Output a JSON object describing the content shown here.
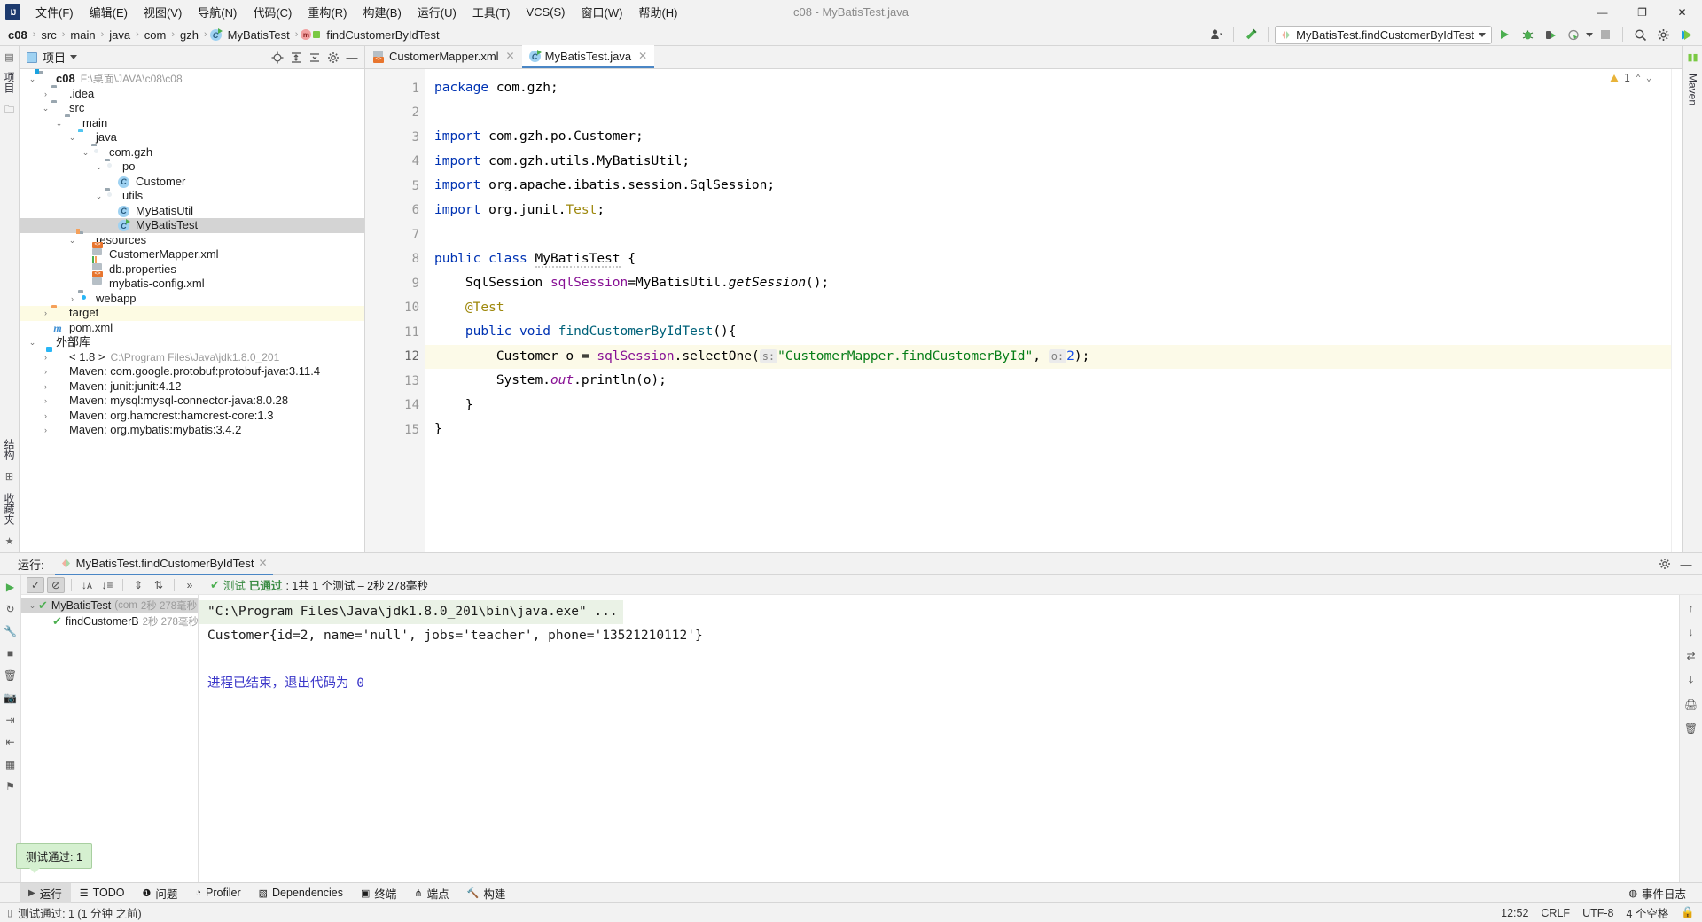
{
  "window": {
    "title": "c08 - MyBatisTest.java",
    "logo": "IJ",
    "minimize": "—",
    "maximize": "❐",
    "close": "✕"
  },
  "menu": {
    "items": [
      "文件(F)",
      "编辑(E)",
      "视图(V)",
      "导航(N)",
      "代码(C)",
      "重构(R)",
      "构建(B)",
      "运行(U)",
      "工具(T)",
      "VCS(S)",
      "窗口(W)",
      "帮助(H)"
    ]
  },
  "breadcrumb": {
    "items": [
      "c08",
      "src",
      "main",
      "java",
      "com",
      "gzh",
      "MyBatisTest",
      "findCustomerByIdTest"
    ],
    "separator": "›"
  },
  "toolbar": {
    "run_config": "MyBatisTest.findCustomerByIdTest",
    "icons": {
      "user": "user-icon",
      "build": "hammer-icon",
      "run": "▶",
      "debug": "debug-icon",
      "coverage": "coverage-icon",
      "profile": "profile-icon",
      "stop": "■",
      "search": "⌕",
      "settings": "⚙",
      "updates": "▶"
    }
  },
  "left_strip": {
    "project_label": "项目",
    "structure_label": "结构",
    "favorites_label": "收藏夹"
  },
  "right_strip": {
    "maven_label": "Maven"
  },
  "project_panel": {
    "title": "项目",
    "head_icons": [
      "target-icon",
      "expand-all-icon",
      "collapse-all-icon",
      "gear-icon",
      "hide-icon"
    ],
    "tree": [
      {
        "depth": 0,
        "arrow": "⌄",
        "icon": "folder-module",
        "label": "c08",
        "bold": true,
        "sub": "F:\\桌面\\JAVA\\c08\\c08",
        "state": "normal"
      },
      {
        "depth": 1,
        "arrow": "›",
        "icon": "folder",
        "label": ".idea",
        "sub": "",
        "state": "normal"
      },
      {
        "depth": 1,
        "arrow": "⌄",
        "icon": "folder",
        "label": "src",
        "sub": "",
        "state": "normal"
      },
      {
        "depth": 2,
        "arrow": "⌄",
        "icon": "folder",
        "label": "main",
        "sub": "",
        "state": "normal"
      },
      {
        "depth": 3,
        "arrow": "⌄",
        "icon": "folder-src",
        "label": "java",
        "sub": "",
        "state": "normal"
      },
      {
        "depth": 4,
        "arrow": "⌄",
        "icon": "folder-pkg",
        "label": "com.gzh",
        "sub": "",
        "state": "normal"
      },
      {
        "depth": 5,
        "arrow": "⌄",
        "icon": "folder-pkg",
        "label": "po",
        "sub": "",
        "state": "normal"
      },
      {
        "depth": 6,
        "arrow": "",
        "icon": "class",
        "label": "Customer",
        "sub": "",
        "state": "normal"
      },
      {
        "depth": 5,
        "arrow": "⌄",
        "icon": "folder-pkg",
        "label": "utils",
        "sub": "",
        "state": "normal"
      },
      {
        "depth": 6,
        "arrow": "",
        "icon": "class",
        "label": "MyBatisUtil",
        "sub": "",
        "state": "normal"
      },
      {
        "depth": 6,
        "arrow": "",
        "icon": "class-run",
        "label": "MyBatisTest",
        "sub": "",
        "state": "selected"
      },
      {
        "depth": 3,
        "arrow": "⌄",
        "icon": "folder-res",
        "label": "resources",
        "sub": "",
        "state": "normal"
      },
      {
        "depth": 4,
        "arrow": "",
        "icon": "xml",
        "label": "CustomerMapper.xml",
        "sub": "",
        "state": "normal"
      },
      {
        "depth": 4,
        "arrow": "",
        "icon": "properties",
        "label": "db.properties",
        "sub": "",
        "state": "normal"
      },
      {
        "depth": 4,
        "arrow": "",
        "icon": "xml",
        "label": "mybatis-config.xml",
        "sub": "",
        "state": "normal"
      },
      {
        "depth": 3,
        "arrow": "›",
        "icon": "folder-web",
        "label": "webapp",
        "sub": "",
        "state": "normal"
      },
      {
        "depth": 1,
        "arrow": "›",
        "icon": "folder-target",
        "label": "target",
        "sub": "",
        "state": "highlight"
      },
      {
        "depth": 1,
        "arrow": "",
        "icon": "pom",
        "label": "pom.xml",
        "sub": "",
        "state": "normal"
      },
      {
        "depth": 0,
        "arrow": "⌄",
        "icon": "lib",
        "label": "外部库",
        "sub": "",
        "state": "normal"
      },
      {
        "depth": 1,
        "arrow": "›",
        "icon": "jdk",
        "label": "< 1.8 >",
        "sub": "C:\\Program Files\\Java\\jdk1.8.0_201",
        "state": "normal"
      },
      {
        "depth": 1,
        "arrow": "›",
        "icon": "maven",
        "label": "Maven: com.google.protobuf:protobuf-java:3.11.4",
        "sub": "",
        "state": "normal"
      },
      {
        "depth": 1,
        "arrow": "›",
        "icon": "maven",
        "label": "Maven: junit:junit:4.12",
        "sub": "",
        "state": "normal"
      },
      {
        "depth": 1,
        "arrow": "›",
        "icon": "maven",
        "label": "Maven: mysql:mysql-connector-java:8.0.28",
        "sub": "",
        "state": "normal"
      },
      {
        "depth": 1,
        "arrow": "›",
        "icon": "maven",
        "label": "Maven: org.hamcrest:hamcrest-core:1.3",
        "sub": "",
        "state": "normal"
      },
      {
        "depth": 1,
        "arrow": "›",
        "icon": "maven",
        "label": "Maven: org.mybatis:mybatis:3.4.2",
        "sub": "",
        "state": "normal"
      }
    ]
  },
  "editor": {
    "tabs": [
      {
        "label": "CustomerMapper.xml",
        "icon": "xml-file-icon",
        "active": false
      },
      {
        "label": "MyBatisTest.java",
        "icon": "java-class-icon",
        "active": true
      }
    ],
    "warning_count": "1",
    "lines": [
      {
        "no": "1",
        "marker": "",
        "fold": "",
        "highlight": false
      },
      {
        "no": "2",
        "marker": "",
        "fold": "",
        "highlight": false
      },
      {
        "no": "3",
        "marker": "",
        "fold": "minus",
        "highlight": false
      },
      {
        "no": "4",
        "marker": "",
        "fold": "",
        "highlight": false
      },
      {
        "no": "5",
        "marker": "",
        "fold": "",
        "highlight": false
      },
      {
        "no": "6",
        "marker": "",
        "fold": "end",
        "highlight": false
      },
      {
        "no": "7",
        "marker": "",
        "fold": "",
        "highlight": false
      },
      {
        "no": "8",
        "marker": "run",
        "fold": "",
        "highlight": false
      },
      {
        "no": "9",
        "marker": "",
        "fold": "",
        "highlight": false
      },
      {
        "no": "10",
        "marker": "",
        "fold": "",
        "highlight": false
      },
      {
        "no": "11",
        "marker": "run",
        "fold": "minus",
        "highlight": false
      },
      {
        "no": "12",
        "marker": "bulb",
        "fold": "",
        "highlight": true
      },
      {
        "no": "13",
        "marker": "",
        "fold": "",
        "highlight": false
      },
      {
        "no": "14",
        "marker": "",
        "fold": "end",
        "highlight": false
      },
      {
        "no": "15",
        "marker": "",
        "fold": "",
        "highlight": false
      }
    ],
    "code": {
      "l1_package": "package",
      "l1_name": " com.gzh;",
      "l3_kw": "import",
      "l3_rest": " com.gzh.po.Customer;",
      "l4_kw": "import",
      "l4_rest": " com.gzh.utils.MyBatisUtil;",
      "l5_kw": "import",
      "l5_rest": " org.apache.ibatis.session.SqlSession;",
      "l6_kw": "import",
      "l6_rest": " org.junit.",
      "l6_type": "Test",
      "l6_semi": ";",
      "l8_pub": "public",
      "l8_cls": "class",
      "l8_name": "MyBatisTest",
      "l8_brace": " {",
      "l9_type": "SqlSession ",
      "l9_var": "sqlSession",
      "l9_eq": "=MyBatisUtil.",
      "l9_mth": "getSession",
      "l9_end": "();",
      "l10_annot": "@Test",
      "l11_pub": "public",
      "l11_void": "void",
      "l11_name": "findCustomerByIdTest",
      "l11_end": "(){",
      "l12_a": "Customer o = ",
      "l12_var": "sqlSession",
      "l12_dot": ".selectOne(",
      "l12_hint1": "s:",
      "l12_str": "\"CustomerMapper.findCustomerById\"",
      "l12_comma": ", ",
      "l12_hint2": "o:",
      "l12_num": "2",
      "l12_end": ");",
      "l13_a": "System.",
      "l13_out": "out",
      "l13_b": ".println(o);",
      "l14_brace": "}",
      "l15_brace": "}"
    }
  },
  "run_panel": {
    "head_label": "运行:",
    "tab_label": "MyBatisTest.findCustomerByIdTest",
    "test_status": {
      "prefix": "测试",
      "passed": "已通过",
      "detail": ": 1共 1 个测试 – 2秒 278毫秒"
    },
    "tree": [
      {
        "depth": 0,
        "arrow": "⌄",
        "name": "MyBatisTest",
        "suffix": "(com",
        "time": "2秒 278毫秒"
      },
      {
        "depth": 1,
        "arrow": "",
        "name": "findCustomerB",
        "suffix": "",
        "time": "2秒 278毫秒"
      }
    ],
    "console": [
      {
        "text": "\"C:\\Program Files\\Java\\jdk1.8.0_201\\bin\\java.exe\" ...",
        "style": "cmd"
      },
      {
        "text": "Customer{id=2, name='null', jobs='teacher', phone='13521210112'}",
        "style": "normal"
      },
      {
        "text": "",
        "style": "normal"
      },
      {
        "text": "进程已结束，退出代码为 0",
        "style": "exit"
      }
    ]
  },
  "tooltip": {
    "text": "测试通过: 1"
  },
  "toolwindow_bar": {
    "items": [
      {
        "label": "运行",
        "icon": "play-icon",
        "active": true
      },
      {
        "label": "TODO",
        "icon": "list-icon",
        "active": false
      },
      {
        "label": "问题",
        "icon": "error-icon",
        "active": false
      },
      {
        "label": "Profiler",
        "icon": "profiler-icon",
        "active": false
      },
      {
        "label": "Dependencies",
        "icon": "layers-icon",
        "active": false
      },
      {
        "label": "终端",
        "icon": "terminal-icon",
        "active": false
      },
      {
        "label": "端点",
        "icon": "endpoints-icon",
        "active": false
      },
      {
        "label": "构建",
        "icon": "build-icon",
        "active": false
      }
    ],
    "event_log": "事件日志"
  },
  "statusbar": {
    "message": "测试通过: 1 (1 分钟 之前)",
    "right": [
      "12:52",
      "CRLF",
      "UTF-8",
      "4 个空格"
    ]
  },
  "colors": {
    "accent": "#4a86c5",
    "success": "#4caf50",
    "warning": "#e8b339",
    "string": "#067d17",
    "keyword": "#0033b3",
    "field": "#871094",
    "number": "#1750eb"
  }
}
